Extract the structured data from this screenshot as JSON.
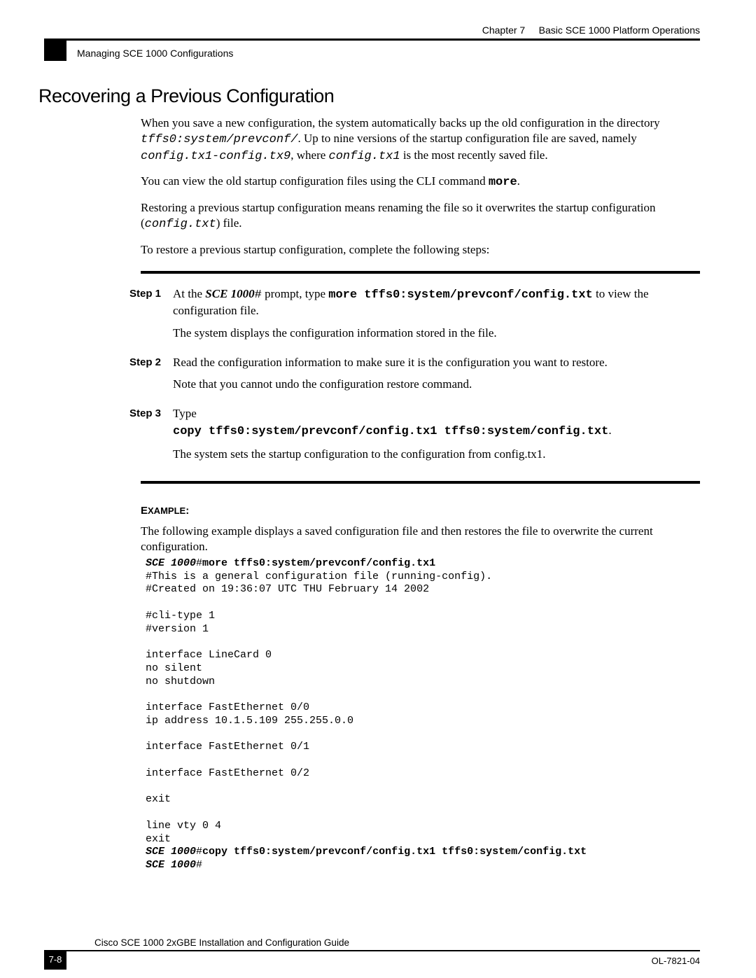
{
  "header": {
    "chapter": "Chapter 7",
    "title": "Basic SCE 1000 Platform Operations",
    "subhead": "Managing SCE 1000 Configurations"
  },
  "h1": "Recovering a Previous Configuration",
  "intro": {
    "p1a": "When you save a new configuration, the system automatically backs up the old configuration in the directory ",
    "p1b": "tffs0:system/prevconf/",
    "p1c": ". Up to nine versions of the startup configuration file are saved, namely ",
    "p1d": "config.tx1-config.tx9",
    "p1e": ", where ",
    "p1f": "config.tx1",
    "p1g": " is the most recently saved file.",
    "p2a": "You can view the old startup configuration files using the CLI command ",
    "p2b": "more",
    "p2c": ".",
    "p3a": "Restoring a previous startup configuration means renaming the file so it overwrites the startup configuration (",
    "p3b": "config.txt",
    "p3c": ") file.",
    "p4": "To restore a previous startup configuration, complete the following steps:"
  },
  "steps": {
    "s1": {
      "label": "Step 1",
      "p1a": "At the ",
      "p1b": "SCE 1000",
      "p1c": "#",
      "p1d": " prompt, type ",
      "p1e": "more tffs0:system/prevconf/config.txt",
      "p1f": " to view the configuration file.",
      "p2": "The system displays the configuration information stored in the file."
    },
    "s2": {
      "label": "Step 2",
      "p1": "Read the configuration information to make sure it is the configuration you want to restore.",
      "p2": "Note that you cannot undo the configuration restore command."
    },
    "s3": {
      "label": "Step 3",
      "p1": "Type",
      "cmd": "copy tffs0:system/prevconf/config.tx1 tffs0:system/config.txt",
      "p2": "The system sets the startup configuration to the configuration from config.tx1."
    }
  },
  "example": {
    "label": "EXAMPLE:",
    "intro": "The following example displays a saved configuration file and then restores the file to overwrite the current configuration.",
    "prompt1_a": "SCE 1000",
    "prompt1_b": "#",
    "prompt1_c": "more tffs0:system/prevconf/config.tx1",
    "line2": "#This is a general configuration file (running-config).",
    "line3": "#Created on 19:36:07 UTC THU February 14 2002",
    "line5": "#cli-type 1",
    "line6": "#version 1",
    "line8": "interface LineCard 0",
    "line9": "no silent",
    "line10": "no shutdown",
    "line12": "interface FastEthernet 0/0",
    "line13": "ip address 10.1.5.109 255.255.0.0",
    "line15": "interface FastEthernet 0/1",
    "line17": "interface FastEthernet 0/2",
    "line19": "exit",
    "line21": "line vty 0 4",
    "line22": "exit",
    "prompt2_a": "SCE 1000",
    "prompt2_b": "#",
    "prompt2_c": "copy tffs0:system/prevconf/config.tx1 tffs0:system/config.txt",
    "prompt3_a": "SCE 1000",
    "prompt3_b": "#"
  },
  "footer": {
    "title": "Cisco SCE 1000 2xGBE Installation and Configuration Guide",
    "page": "7-8",
    "docid": "OL-7821-04"
  }
}
